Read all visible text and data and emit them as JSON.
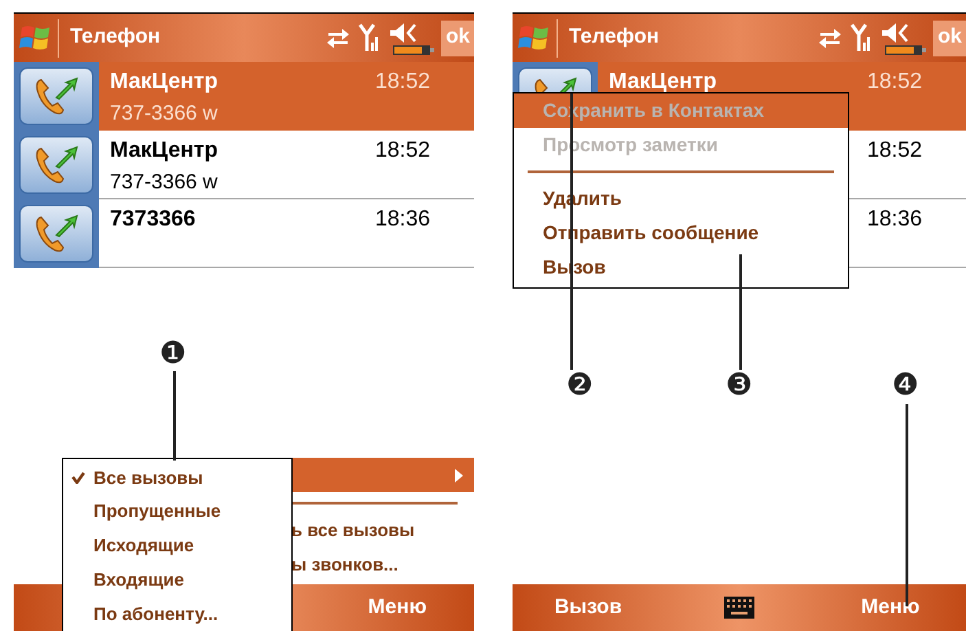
{
  "screens": [
    {
      "title": "Телефон",
      "ok": "ok",
      "calls": [
        {
          "name": "МакЦентр",
          "number": "737-3366 w",
          "time": "18:52",
          "selected": true
        },
        {
          "name": "МакЦентр",
          "number": "737-3366 w",
          "time": "18:52",
          "selected": false
        },
        {
          "name": "7373366",
          "time": "18:36",
          "selected": false
        }
      ],
      "bottom_bar": {
        "right": "Меню"
      },
      "back_menu": [
        {
          "kind": "submenu",
          "selected": true
        },
        {
          "kind": "separator"
        },
        {
          "kind": "item",
          "label": "ь все вызовы",
          "selected": false
        },
        {
          "kind": "item",
          "label": "ы звонков...",
          "selected": false
        }
      ],
      "filter_menu": [
        {
          "label": "Все вызовы",
          "checked": true
        },
        {
          "label": "Пропущенные",
          "checked": false
        },
        {
          "label": "Исходящие",
          "checked": false
        },
        {
          "label": "Входящие",
          "checked": false
        },
        {
          "label": "По абоненту...",
          "checked": false
        }
      ]
    },
    {
      "title": "Телефон",
      "ok": "ok",
      "calls": [
        {
          "name": "МакЦентр",
          "time": "18:52",
          "selected": true
        },
        {
          "time": "18:52",
          "selected": false
        },
        {
          "time": "18:36",
          "selected": false
        }
      ],
      "bottom_bar": {
        "left": "Вызов",
        "keyboard": true,
        "right": "Меню"
      },
      "context_menu": [
        {
          "kind": "item",
          "label": "Сохранить в Контактах",
          "disabled": true,
          "selected": true
        },
        {
          "kind": "item",
          "label": "Просмотр заметки",
          "disabled": true,
          "selected": false
        },
        {
          "kind": "separator"
        },
        {
          "kind": "item",
          "label": "Удалить",
          "disabled": false,
          "selected": false
        },
        {
          "kind": "item",
          "label": "Отправить сообщение",
          "disabled": false,
          "selected": false
        },
        {
          "kind": "item",
          "label": "Вызов",
          "disabled": false,
          "selected": false
        }
      ]
    }
  ],
  "callouts": [
    "❶",
    "❷",
    "❸",
    "❹"
  ]
}
